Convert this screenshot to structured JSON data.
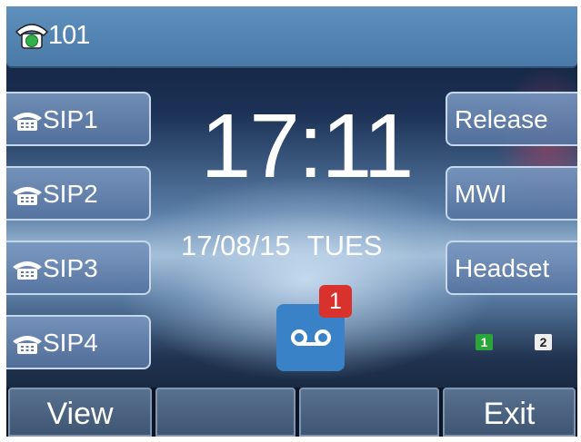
{
  "status": {
    "account": "101",
    "icon": "phone-registered-icon"
  },
  "line_keys": [
    {
      "label": "SIP1",
      "icon": "phone-icon"
    },
    {
      "label": "SIP2",
      "icon": "phone-icon"
    },
    {
      "label": "SIP3",
      "icon": "phone-icon"
    },
    {
      "label": "SIP4",
      "icon": "phone-icon"
    }
  ],
  "right_keys": [
    {
      "label": "Release"
    },
    {
      "label": "MWI"
    },
    {
      "label": "Headset"
    }
  ],
  "clock": {
    "time": "17:11",
    "date": "17/08/15 TUES"
  },
  "voicemail": {
    "count": "1",
    "icon": "voicemail-icon",
    "badge_color": "#d9312b"
  },
  "accounts": [
    {
      "label": "1",
      "color": "#2aa53a",
      "text_color": "#ffffff"
    },
    {
      "label": "2",
      "color": "#eeeeee",
      "text_color": "#222222"
    }
  ],
  "soft_keys": [
    {
      "label": "View"
    },
    {
      "label": ""
    },
    {
      "label": ""
    },
    {
      "label": "Exit"
    }
  ]
}
